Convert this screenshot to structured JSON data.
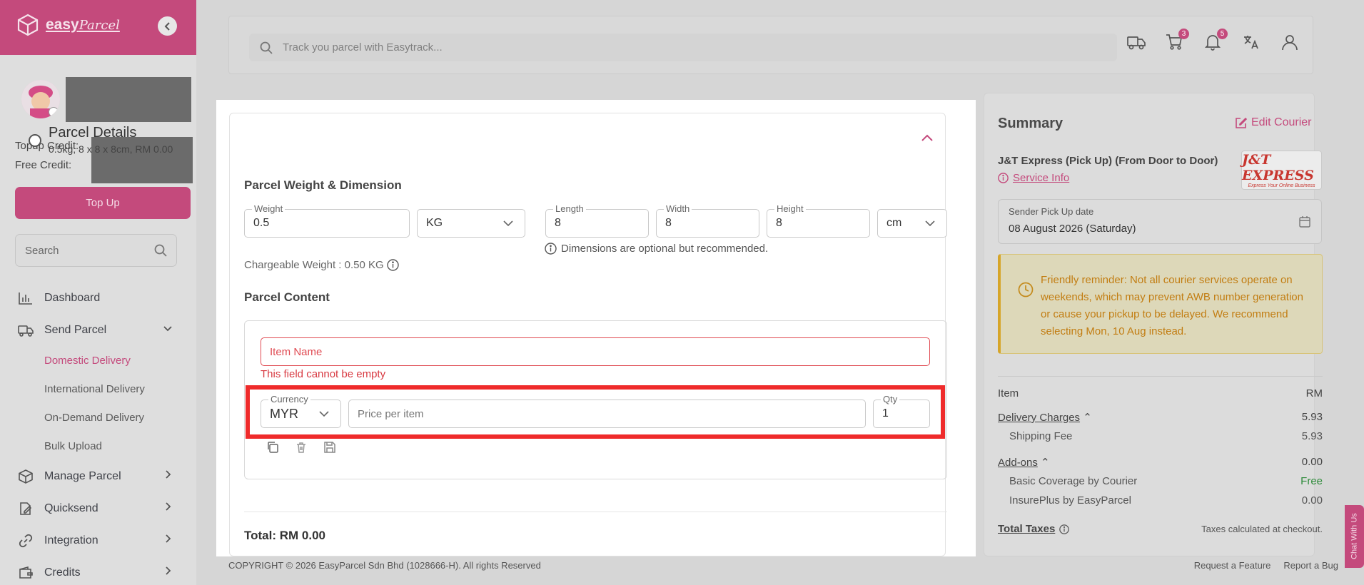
{
  "brand": {
    "name_bold": "easy",
    "name_script": "Parcel",
    "color": "#c44a7c"
  },
  "sidebar": {
    "topup_credit_label": "Topup Credit:",
    "free_credit_label": "Free Credit:",
    "topup_button": "Top Up",
    "search_placeholder": "Search",
    "items": [
      {
        "label": "Dashboard",
        "icon": "chart-icon"
      },
      {
        "label": "Send Parcel",
        "icon": "truck-icon",
        "expanded": true,
        "children": [
          "Domestic Delivery",
          "International Delivery",
          "On-Demand Delivery",
          "Bulk Upload"
        ],
        "active_child": "Domestic Delivery"
      },
      {
        "label": "Manage Parcel",
        "icon": "box-icon"
      },
      {
        "label": "Quicksend",
        "icon": "edit-icon"
      },
      {
        "label": "Integration",
        "icon": "link-icon"
      },
      {
        "label": "Credits",
        "icon": "wallet-icon"
      }
    ]
  },
  "topbar": {
    "track_placeholder": "Track you parcel with Easytrack...",
    "cart_count": "3",
    "notification_count": "5"
  },
  "parcel": {
    "title": "Parcel Details",
    "subtitle": "0.5kg, 8 x 8 x 8cm, RM 0.00",
    "weight_dim_label": "Parcel Weight & Dimension",
    "weight_label": "Weight",
    "weight_value": "0.5",
    "weight_unit": "KG",
    "length_label": "Length",
    "length_value": "8",
    "width_label": "Width",
    "width_value": "8",
    "height_label": "Height",
    "height_value": "8",
    "dim_unit": "cm",
    "dim_hint": "Dimensions are optional but recommended.",
    "chargeable_weight": "Chargeable Weight : 0.50 KG",
    "content_label": "Parcel Content",
    "item_name_placeholder": "Item Name",
    "item_name_error": "This field cannot be empty",
    "currency_label": "Currency",
    "currency_value": "MYR",
    "price_placeholder": "Price per item",
    "qty_label": "Qty",
    "qty_value": "1",
    "total": "Total: RM 0.00"
  },
  "summary": {
    "title": "Summary",
    "edit_courier": "Edit Courier",
    "courier_name": "J&T Express (Pick Up) (From Door to Door)",
    "service_info": "Service Info",
    "courier_logo_text": "J&T EXPRESS",
    "courier_logo_tagline": "Express Your Online Business",
    "pickup_label": "Sender Pick Up date",
    "pickup_value": "08 August 2026 (Saturday)",
    "reminder": "Friendly reminder: Not all courier services operate on weekends, which may prevent AWB number generation or cause your pickup to be delayed. We recommend selecting Mon, 10 Aug instead.",
    "item_header": "Item",
    "rm_header": "RM",
    "delivery_charges": "Delivery Charges",
    "delivery_charges_value": "5.93",
    "shipping_fee": "Shipping Fee",
    "shipping_fee_value": "5.93",
    "addons": "Add-ons",
    "addons_value": "0.00",
    "basic_coverage": "Basic Coverage by Courier",
    "basic_coverage_value": "Free",
    "insureplus": "InsurePlus by EasyParcel",
    "insureplus_value": "0.00",
    "total_taxes": "Total Taxes",
    "taxes_note": "Taxes calculated at checkout."
  },
  "chat_tab": "Chat With Us",
  "footer": {
    "copyright": "COPYRIGHT © 2026 EasyParcel Sdn Bhd (1028666-H). All rights Reserved",
    "request_feature": "Request a Feature",
    "report_bug": "Report a Bug"
  }
}
